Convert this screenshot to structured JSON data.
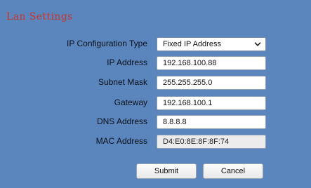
{
  "title": "Lan Settings",
  "form": {
    "ip_config_type": {
      "label": "IP Configuration Type",
      "selected": "Fixed IP Address"
    },
    "ip_address": {
      "label": "IP Address",
      "value": "192.168.100.88"
    },
    "subnet_mask": {
      "label": "Subnet Mask",
      "value": "255.255.255.0"
    },
    "gateway": {
      "label": "Gateway",
      "value": "192.168.100.1"
    },
    "dns_address": {
      "label": "DNS Address",
      "value": "8.8.8.8"
    },
    "mac_address": {
      "label": "MAC Address",
      "value": "D4:E0:8E:8F:8F:74"
    }
  },
  "buttons": {
    "submit": "Submit",
    "cancel": "Cancel"
  },
  "icons": {
    "dropdown": "chevron-down-icon"
  },
  "colors": {
    "background": "#5b86bd",
    "title": "#c8352c"
  }
}
